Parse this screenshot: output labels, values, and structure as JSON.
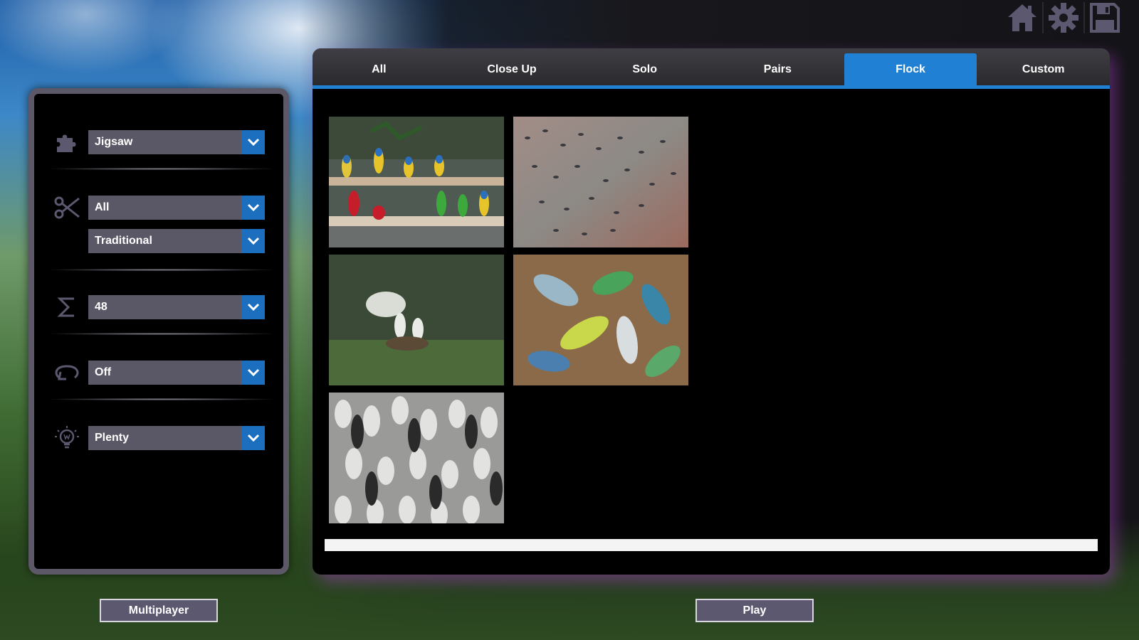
{
  "top_icons": [
    "home-icon",
    "gear-icon",
    "save-icon"
  ],
  "options": {
    "style": {
      "icon": "puzzle-icon",
      "value": "Jigsaw"
    },
    "cut_set": {
      "icon": "scissors-icon",
      "value": "All"
    },
    "cut_style": {
      "value": "Traditional"
    },
    "piece_count": {
      "icon": "sigma-icon",
      "value": "48"
    },
    "rotation": {
      "icon": "rotate-icon",
      "value": "Off"
    },
    "hints": {
      "icon": "lightbulb-icon",
      "value": "Plenty"
    }
  },
  "tabs": [
    {
      "label": "All",
      "active": false
    },
    {
      "label": "Close Up",
      "active": false
    },
    {
      "label": "Solo",
      "active": false
    },
    {
      "label": "Pairs",
      "active": false
    },
    {
      "label": "Flock",
      "active": true
    },
    {
      "label": "Custom",
      "active": false
    }
  ],
  "puzzles": [
    "macaws-on-perch",
    "flock-of-birds-on-rock",
    "egrets-in-nest",
    "budgerigars-pile",
    "penguin-colony"
  ],
  "buttons": {
    "multiplayer": "Multiplayer",
    "play": "Play"
  },
  "colors": {
    "accent": "#1f80d4",
    "panel_border": "#5d5868",
    "dropdown_bg": "#5a5866"
  }
}
